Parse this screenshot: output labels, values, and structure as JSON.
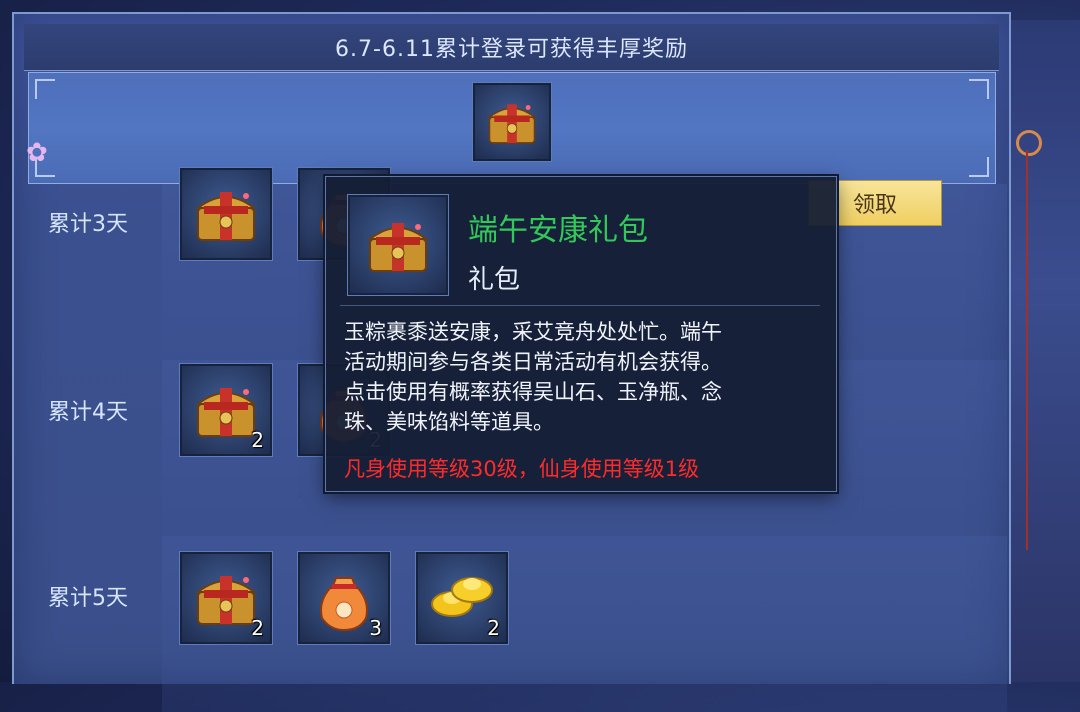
{
  "header": {
    "title": "6.7-6.11累计登录可获得丰厚奖励"
  },
  "rows": [
    {
      "label": "累计3天",
      "claim_label": "领取",
      "items": [
        {
          "icon": "treasure-chest",
          "count": ""
        },
        {
          "icon": "lucky-bag",
          "count": ""
        }
      ]
    },
    {
      "label": "累计4天",
      "items": [
        {
          "icon": "treasure-chest",
          "count": "2"
        },
        {
          "icon": "lucky-bag",
          "count": "2"
        }
      ]
    },
    {
      "label": "累计5天",
      "items": [
        {
          "icon": "treasure-chest",
          "count": "2"
        },
        {
          "icon": "lucky-bag",
          "count": "3"
        },
        {
          "icon": "gold-ingot",
          "count": "2"
        }
      ]
    }
  ],
  "tooltip": {
    "name": "端午安康礼包",
    "type": "礼包",
    "desc_lines": [
      "玉粽裹黍送安康，采艾竞舟处处忙。端午",
      "活动期间参与各类日常活动有机会获得。",
      "点击使用有概率获得吴山石、玉净瓶、念",
      "珠、美味馅料等道具。"
    ],
    "requirement": "凡身使用等级30级，仙身使用等级1级",
    "name_color": "#33c95a",
    "requirement_color": "#ff2b2b"
  },
  "colors": {
    "claim_button": "#f3d877",
    "panel": "#3e5396"
  }
}
